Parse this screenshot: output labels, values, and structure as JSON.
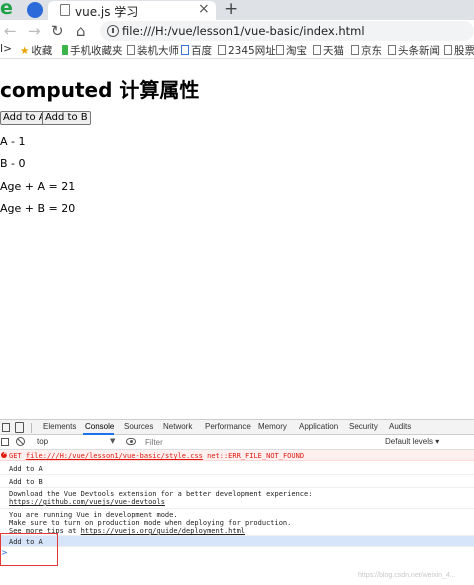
{
  "browser": {
    "tab_title": "vue.js 学习",
    "url": "file:///H:/vue/lesson1/vue-basic/index.html",
    "icons": {
      "logo": "e",
      "back": "←",
      "forward": "→",
      "reload": "↻",
      "home": "⌂",
      "close": "×",
      "new_tab": "+"
    }
  },
  "bookmarks": {
    "items": [
      "I>",
      "收藏",
      "手机收藏夹",
      "装机大师",
      "百度",
      "2345网址",
      "淘宝",
      "天猫",
      "京东",
      "头条新闻",
      "股票"
    ]
  },
  "page": {
    "heading": "computed 计算属性",
    "buttons": [
      "Add to A",
      "Add to B"
    ],
    "lines": [
      "A - 1",
      "B - 0",
      "Age + A = 21",
      "Age + B = 20"
    ]
  },
  "devtools": {
    "tabs": [
      "Elements",
      "Console",
      "Sources",
      "Network",
      "Performance",
      "Memory",
      "Application",
      "Security",
      "Audits"
    ],
    "active_tab": "Console",
    "context": "top",
    "filter_placeholder": "Filter",
    "levels": "Default levels ▾",
    "console": {
      "error": {
        "method": "GET",
        "url": "file:///H:/vue/lesson1/vue-basic/style.css",
        "message": "net::ERR_FILE_NOT_FOUND"
      },
      "log1": "Add to A",
      "log2": "Add to B",
      "devtools_msg": {
        "line1": "Download the Vue Devtools extension for a better development experience:",
        "line2": "https://github.com/vuejs/vue-devtools"
      },
      "prod_msg": {
        "line1": "You are running Vue in development mode.",
        "line2": "Make sure to turn on production mode when deploying for production.",
        "line3a": "See more tips at ",
        "line3b": "https://vuejs.org/guide/deployment.html"
      },
      "log3": "Add to A",
      "prompt": ">"
    }
  },
  "watermark": "https://blog.csdn.net/weixin_4..."
}
